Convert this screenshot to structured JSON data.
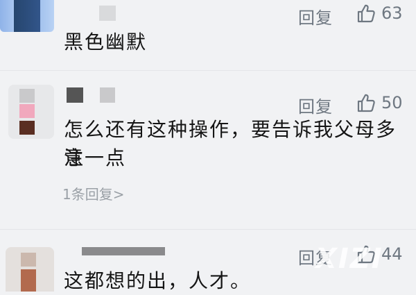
{
  "comments": [
    {
      "reply_label": "回复",
      "likes": "63",
      "text_lines": [
        "黑色幽默"
      ]
    },
    {
      "reply_label": "回复",
      "likes": "50",
      "text_lines": [
        "怎么还有这种操作，要告诉我父母多注",
        "意一点"
      ],
      "replies_link": "1条回复>"
    },
    {
      "reply_label": "回复",
      "likes": "44",
      "text_lines": [
        "这都想的出，人才。"
      ]
    }
  ],
  "icons": {
    "like": "thumbs-up-icon"
  },
  "colors": {
    "background": "#f1f2f4",
    "secondary_text": "#6e7781",
    "primary_text": "#151515"
  }
}
